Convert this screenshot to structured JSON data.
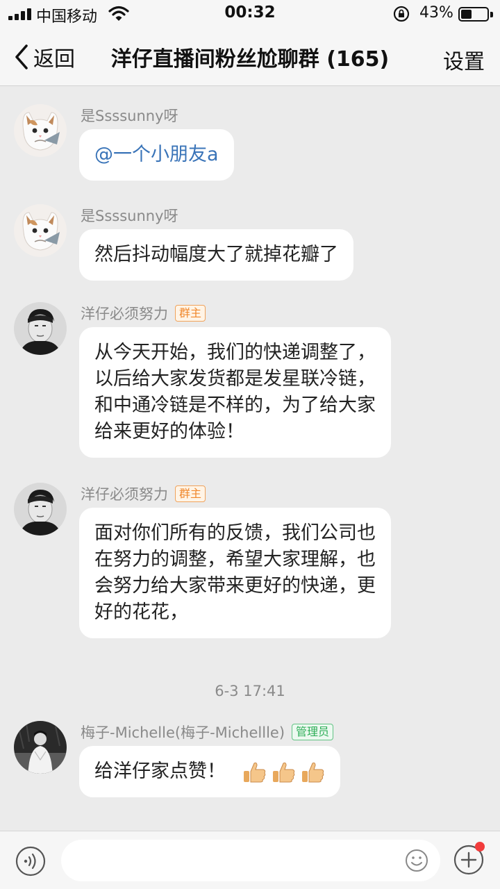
{
  "status_bar": {
    "carrier": "中国移动",
    "time": "00:32",
    "battery_percent": "43%",
    "battery_level": 0.43,
    "icons": [
      "signal-icon",
      "wifi-icon",
      "orientation-lock-icon",
      "battery-icon"
    ]
  },
  "nav": {
    "back_label": "返回",
    "title": "洋仔直播间粉丝尬聊群 (165)",
    "settings_label": "设置",
    "icons": [
      "chevron-left-icon"
    ]
  },
  "messages": [
    {
      "sender": "是Ssssunny呀",
      "mention": "@一个小朋友a",
      "avatar": "cat-avatar"
    },
    {
      "sender": "是Ssssunny呀",
      "text": "然后抖动幅度大了就掉花瓣了",
      "avatar": "cat-avatar"
    },
    {
      "sender": "洋仔必须努力",
      "badge": "群主",
      "lines": [
        "从今天开始，我们的快递调整了，",
        "以后给大家发货都是发星联冷链，",
        "和中通冷链是不样的，为了给大家",
        "给来更好的体验！"
      ],
      "avatar": "man-avatar"
    },
    {
      "sender": "洋仔必须努力",
      "badge": "群主",
      "lines": [
        "面对你们所有的反馈，我们公司也",
        "在努力的调整，希望大家理解，也",
        "会努力给大家带来更好的快递，更",
        "好的花花，"
      ],
      "avatar": "man-avatar"
    },
    {
      "sender": "梅子-Michelle(梅子-Michellle)",
      "badge": "管理员",
      "text": "给洋仔家点赞！",
      "emoji": "thumbs-up-icon",
      "emoji_count": 3,
      "avatar": "woman-avatar"
    }
  ],
  "timestamp": "6-3 17:41",
  "input_bar": {
    "placeholder": "",
    "icons": [
      "voice-icon",
      "emoji-icon",
      "plus-icon",
      "notification-dot"
    ]
  },
  "colors": {
    "background": "#ebebeb",
    "bar": "#f6f6f6",
    "mention": "#3a74b8",
    "owner_badge": "#f0882c",
    "admin_badge": "#2fae58",
    "notification_dot": "#f23c3c"
  }
}
